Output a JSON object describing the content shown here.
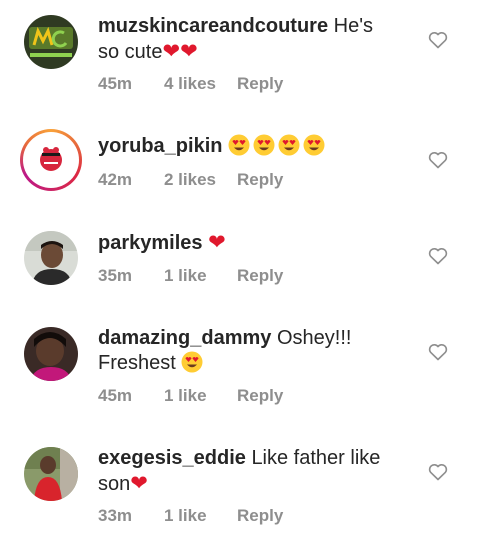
{
  "comments": [
    {
      "username": "muzskincareandcouture",
      "text": "He's so cute",
      "emoji_suffix": "❤❤",
      "time": "45m",
      "likes": "4 likes",
      "reply": "Reply",
      "avatar_icon": "brand-logo-avatar"
    },
    {
      "username": "yoruba_pikin",
      "text": "",
      "emoji_suffix": "😍😍😍😍",
      "time": "42m",
      "likes": "2 likes",
      "reply": "Reply",
      "avatar_icon": "story-ring-avatar"
    },
    {
      "username": "parkymiles",
      "text": "",
      "emoji_suffix": "❤",
      "time": "35m",
      "likes": "1 like",
      "reply": "Reply",
      "avatar_icon": "user-photo-avatar"
    },
    {
      "username": "damazing_dammy",
      "text": "Oshey!!! Freshest",
      "emoji_suffix": "😍",
      "time": "45m",
      "likes": "1 like",
      "reply": "Reply",
      "avatar_icon": "user-photo-avatar"
    },
    {
      "username": "exegesis_eddie",
      "text": "Like father like son",
      "emoji_suffix": "❤",
      "time": "33m",
      "likes": "1 like",
      "reply": "Reply",
      "avatar_icon": "user-photo-avatar"
    }
  ],
  "colors": {
    "heart": "#e0182d",
    "meta_text": "#8e8e8e",
    "username": "#262626",
    "icon_outline": "#8e8e8e"
  }
}
